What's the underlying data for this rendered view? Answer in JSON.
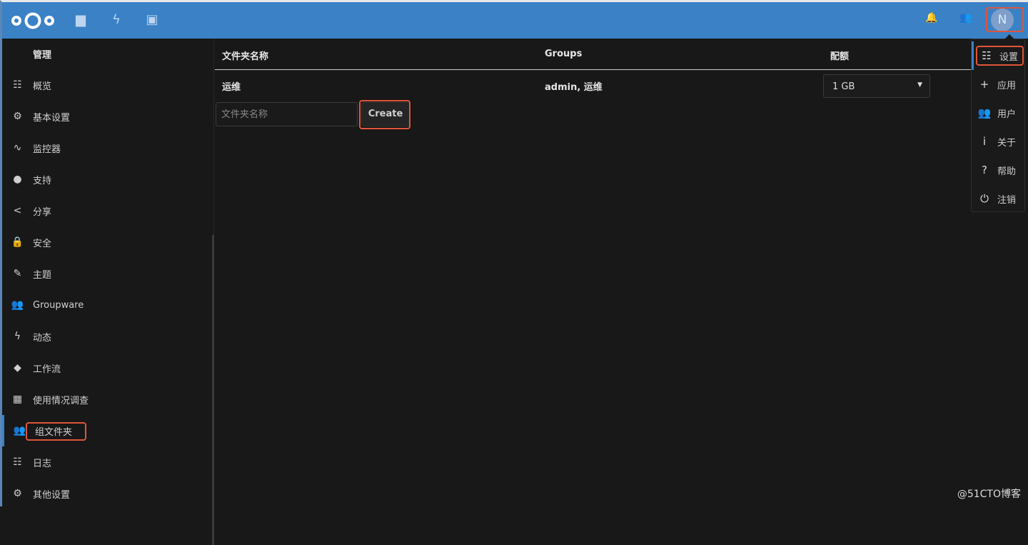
{
  "header": {
    "icons": [
      "nextcloud-logo",
      "files-icon",
      "activity-icon",
      "gallery-icon",
      "notifications-icon",
      "contacts-icon"
    ],
    "avatar_letter": "N",
    "accent": "#3a81c6"
  },
  "sidebar": {
    "title": "管理",
    "items": [
      {
        "label": "概览",
        "icon": "☷"
      },
      {
        "label": "基本设置",
        "icon": "⚙"
      },
      {
        "label": "监控器",
        "icon": "∿"
      },
      {
        "label": "支持",
        "icon": "●"
      },
      {
        "label": "分享",
        "icon": "<"
      },
      {
        "label": "安全",
        "icon": "🔒"
      },
      {
        "label": "主题",
        "icon": "✎"
      },
      {
        "label": "Groupware",
        "icon": "👥"
      },
      {
        "label": "动态",
        "icon": "ϟ"
      },
      {
        "label": "工作流",
        "icon": "◆"
      },
      {
        "label": "使用情况调查",
        "icon": "▦"
      },
      {
        "label": "组文件夹",
        "icon": "👥",
        "active": true
      },
      {
        "label": "日志",
        "icon": "☷"
      },
      {
        "label": "其他设置",
        "icon": "⚙"
      }
    ]
  },
  "table": {
    "headers": [
      "文件夹名称",
      "Groups",
      "配额"
    ],
    "rows": [
      {
        "name": "运维",
        "groups": "admin, 运维",
        "quota": "1 GB"
      }
    ]
  },
  "form": {
    "placeholder": "文件夹名称",
    "create_label": "Create"
  },
  "menu": {
    "items": [
      {
        "label": "设置",
        "icon": "☷",
        "active": true
      },
      {
        "label": "应用",
        "icon": "+"
      },
      {
        "label": "用户",
        "icon": "👥"
      },
      {
        "label": "关于",
        "icon": "i"
      },
      {
        "label": "帮助",
        "icon": "?"
      },
      {
        "label": "注销",
        "icon": "⏻"
      }
    ]
  },
  "watermark": "@51CTO博客"
}
